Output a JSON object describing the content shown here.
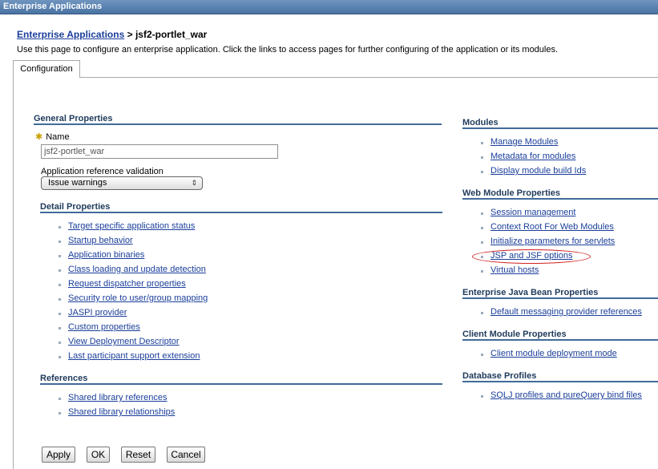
{
  "window": {
    "title": "Enterprise Applications"
  },
  "breadcrumb": {
    "link": "Enterprise Applications",
    "separator": " > ",
    "current": "jsf2-portlet_war"
  },
  "intro": "Use this page to configure an enterprise application. Click the links to access pages for further configuring of the application or its modules.",
  "tabs": [
    {
      "label": "Configuration"
    }
  ],
  "general": {
    "title": "General Properties",
    "name_label": "Name",
    "name_value": "jsf2-portlet_war",
    "validation_label": "Application reference validation",
    "validation_value": "Issue warnings"
  },
  "detail": {
    "title": "Detail Properties",
    "items": [
      "Target specific application status",
      "Startup behavior",
      "Application binaries",
      "Class loading and update detection",
      "Request dispatcher properties",
      "Security role to user/group mapping",
      "JASPI provider",
      "Custom properties",
      "View Deployment Descriptor",
      "Last participant support extension"
    ]
  },
  "references": {
    "title": "References",
    "items": [
      "Shared library references",
      "Shared library relationships"
    ]
  },
  "modules": {
    "title": "Modules",
    "items": [
      "Manage Modules",
      "Metadata for modules",
      "Display module build Ids"
    ]
  },
  "web_module": {
    "title": "Web Module Properties",
    "items": [
      "Session management",
      "Context Root For Web Modules",
      "Initialize parameters for servlets",
      "JSP and JSF options",
      "Virtual hosts"
    ]
  },
  "ejb": {
    "title": "Enterprise Java Bean Properties",
    "items": [
      "Default messaging provider references"
    ]
  },
  "client": {
    "title": "Client Module Properties",
    "items": [
      "Client module deployment mode"
    ]
  },
  "database": {
    "title": "Database Profiles",
    "items": [
      "SQLJ profiles and pureQuery bind files"
    ]
  },
  "buttons": {
    "apply": "Apply",
    "ok": "OK",
    "reset": "Reset",
    "cancel": "Cancel"
  },
  "colors": {
    "titlebar": "#5a82b0",
    "link": "#1a3e9a",
    "rule": "#416b9a",
    "highlight": "#d02020"
  }
}
